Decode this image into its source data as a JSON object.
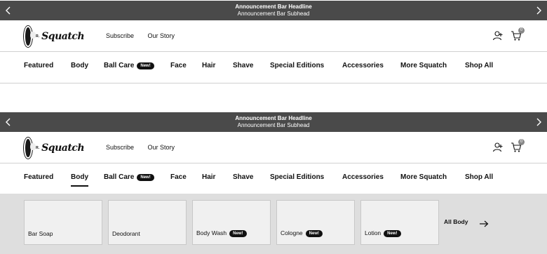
{
  "announcement": {
    "headline": "Announcement Bar Headline",
    "subhead": "Announcement Bar Subhead"
  },
  "logo": {
    "prefix": "DR.",
    "wordmark": "Squatch"
  },
  "header_links": [
    "Subscribe",
    "Our Story"
  ],
  "cart": {
    "count": "0"
  },
  "nav": {
    "items": [
      {
        "label": "Featured"
      },
      {
        "label": "Body"
      },
      {
        "label": "Ball Care",
        "badge": "New!"
      },
      {
        "label": "Face"
      },
      {
        "label": "Hair"
      },
      {
        "label": "Shave"
      },
      {
        "label": "Special Editions"
      },
      {
        "label": "Accessories"
      },
      {
        "label": "More Squatch"
      },
      {
        "label": "Shop All"
      }
    ]
  },
  "dropdown": {
    "active": "Body",
    "cards": [
      {
        "label": "Bar Soap"
      },
      {
        "label": "Deodorant"
      },
      {
        "label": "Body Wash",
        "badge": "New!"
      },
      {
        "label": "Cologne",
        "badge": "New!"
      },
      {
        "label": "Lotion",
        "badge": "New!"
      }
    ],
    "all_label": "All Body"
  }
}
